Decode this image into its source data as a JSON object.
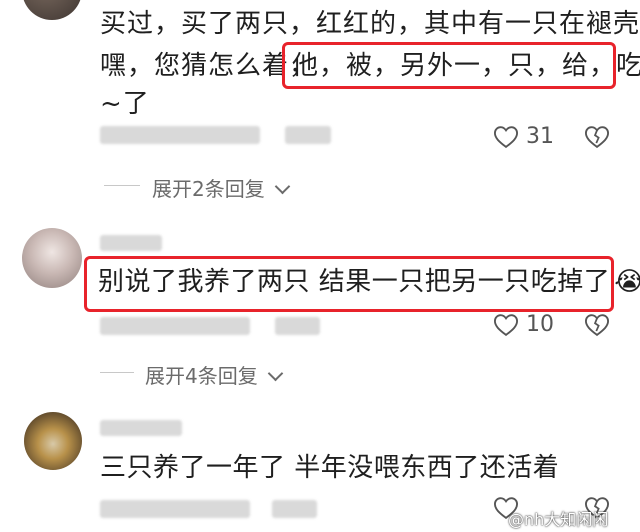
{
  "comments": [
    {
      "lines": [
        "买过，买了两只，红红的，其中有一只在褪壳。",
        "嘿，您猜怎么着，",
        "他，被，另外一，只，给，吃",
        "~了"
      ],
      "likes": "31",
      "replies_label": "展开2条回复"
    },
    {
      "text": "别说了我养了两只 结果一只把另一只吃掉了",
      "emoji": "😭",
      "likes": "10",
      "replies_label": "展开4条回复"
    },
    {
      "text": "三只养了一年了 半年没喂东西了还活着"
    }
  ],
  "watermark": "@nh大知闲闲",
  "colors": {
    "highlight": "#e8232b",
    "text": "#1f1f1f",
    "meta": "#6b6b6b"
  }
}
